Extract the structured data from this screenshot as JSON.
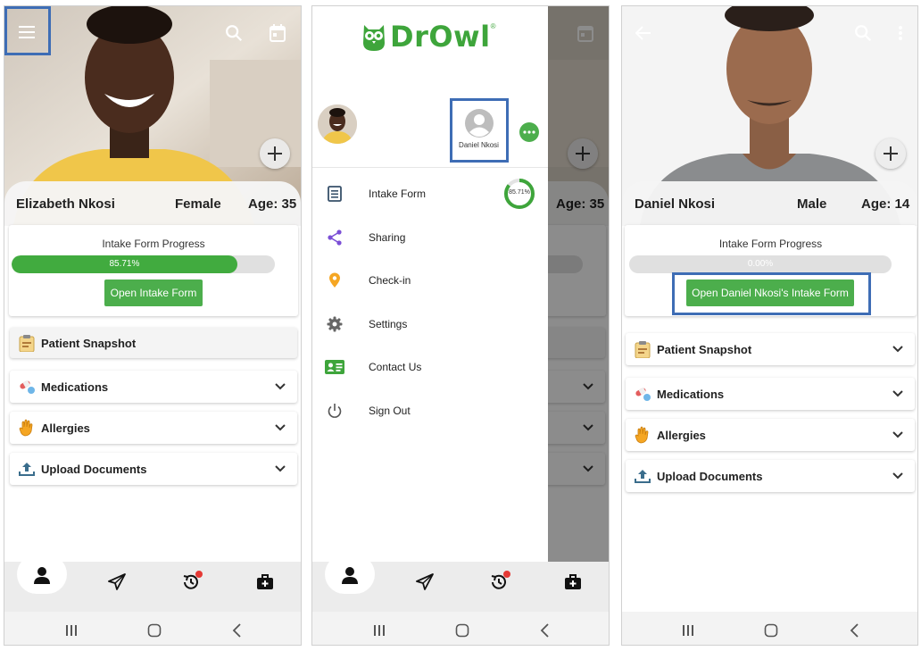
{
  "screen1": {
    "patient": {
      "name": "Elizabeth Nkosi",
      "gender": "Female",
      "age": "Age: 35"
    },
    "progress": {
      "title": "Intake Form Progress",
      "value_label": "85.71%",
      "fraction": 0.8571
    },
    "open_button": "Open Intake Form",
    "sections": [
      "Patient Snapshot",
      "Medications",
      "Allergies",
      "Upload Documents"
    ]
  },
  "screen2": {
    "logo": "DrOwl",
    "logo_mark": "®",
    "other_profile_name": "Daniel Nkosi",
    "menu": [
      "Intake Form",
      "Sharing",
      "Check-in",
      "Settings",
      "Contact Us",
      "Sign Out"
    ],
    "intake_progress_label": "85.71%",
    "intake_progress_fraction": 0.8571,
    "behind_age": "Age: 35"
  },
  "screen3": {
    "patient": {
      "name": "Daniel Nkosi",
      "gender": "Male",
      "age": "Age: 14"
    },
    "progress": {
      "title": "Intake Form Progress",
      "value_label": "0.00%",
      "fraction": 0
    },
    "open_button": "Open Daniel Nkosi's Intake Form",
    "sections": [
      "Patient Snapshot",
      "Medications",
      "Allergies",
      "Upload Documents"
    ]
  },
  "colors": {
    "green": "#4cae4c",
    "highlight": "#3e6db5",
    "badge": "#e53935"
  },
  "icons": [
    "menu-icon",
    "search-icon",
    "calendar-icon",
    "plus-icon",
    "back-arrow-icon",
    "more-vert-icon",
    "clipboard-icon",
    "pills-icon",
    "hand-icon",
    "upload-icon",
    "chevron-down-icon",
    "person-icon",
    "send-icon",
    "history-icon",
    "medkit-icon",
    "form-icon",
    "share-icon",
    "location-pin-icon",
    "gear-icon",
    "contact-card-icon",
    "power-icon"
  ]
}
